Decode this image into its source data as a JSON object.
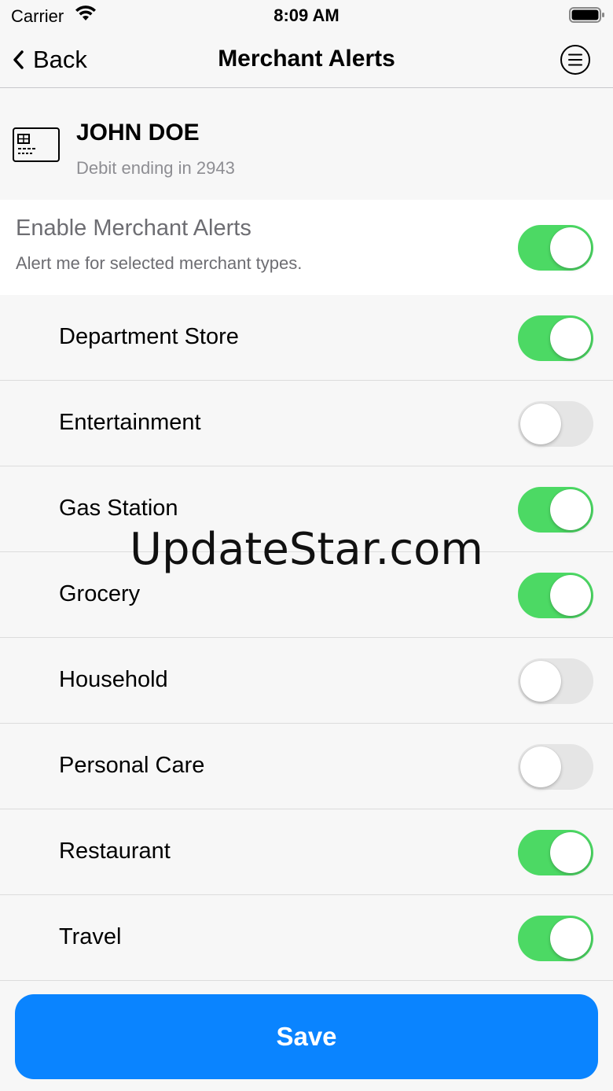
{
  "status_bar": {
    "carrier": "Carrier",
    "time": "8:09 AM",
    "icons": [
      "wifi-icon",
      "battery-icon"
    ]
  },
  "nav": {
    "back_label": "Back",
    "title": "Merchant Alerts",
    "menu_icon": "menu-icon"
  },
  "account": {
    "name": "JOHN DOE",
    "subtitle": "Debit ending in 2943",
    "icon": "credit-card-icon"
  },
  "enable": {
    "title": "Enable Merchant Alerts",
    "subtitle": "Alert me for selected merchant types.",
    "enabled": true
  },
  "merchants": [
    {
      "label": "Department Store",
      "enabled": true
    },
    {
      "label": "Entertainment",
      "enabled": false
    },
    {
      "label": "Gas Station",
      "enabled": true
    },
    {
      "label": "Grocery",
      "enabled": true
    },
    {
      "label": "Household",
      "enabled": false
    },
    {
      "label": "Personal Care",
      "enabled": false
    },
    {
      "label": "Restaurant",
      "enabled": true
    },
    {
      "label": "Travel",
      "enabled": true
    }
  ],
  "watermark": "UpdateStar.com",
  "save_label": "Save",
  "colors": {
    "toggle_on": "#4cd964",
    "toggle_off": "#e5e5e5",
    "primary_button": "#0a84ff"
  }
}
